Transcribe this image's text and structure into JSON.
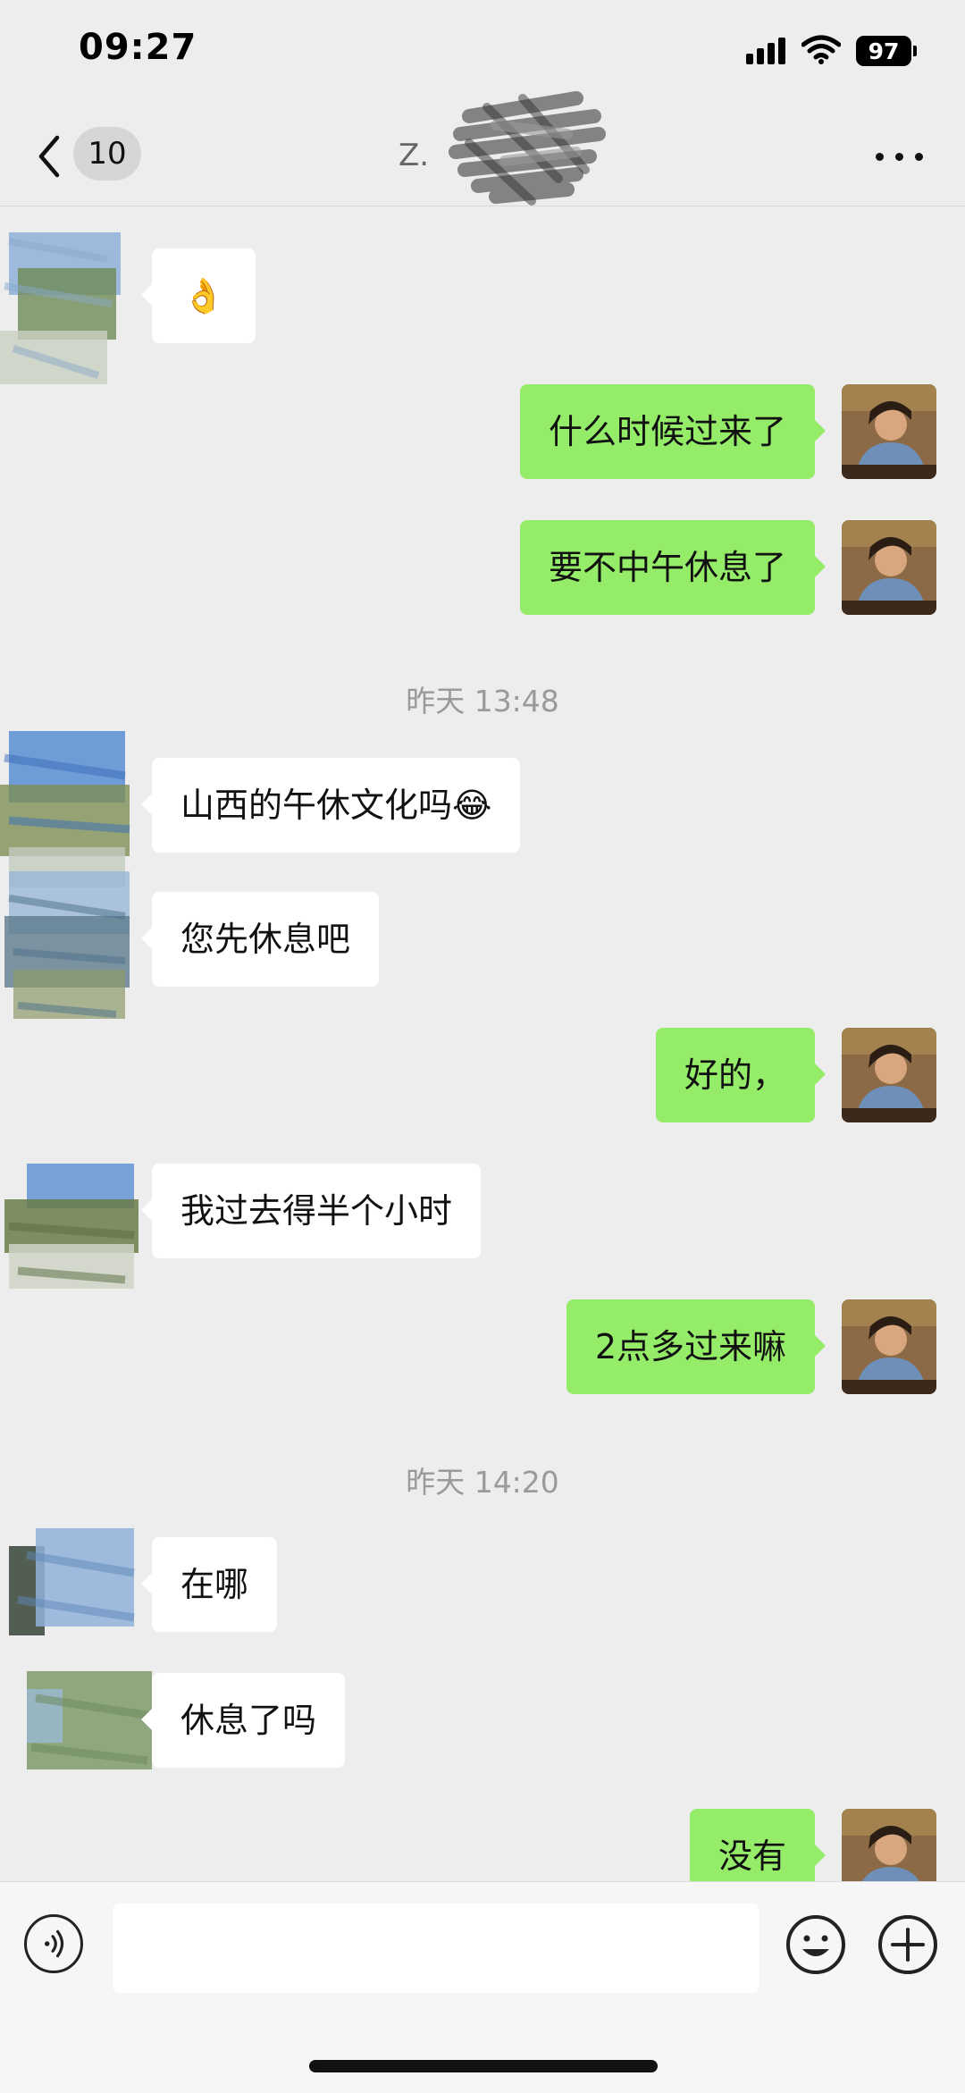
{
  "status_bar": {
    "time": "09:27",
    "battery": "97"
  },
  "nav": {
    "unread_count": "10",
    "title": "Z."
  },
  "messages": [
    {
      "side": "in",
      "text": "👌"
    },
    {
      "side": "out",
      "text": "什么时候过来了"
    },
    {
      "side": "out",
      "text": "要不中午休息了"
    },
    {
      "side": "in",
      "text": "山西的午休文化吗😂"
    },
    {
      "side": "in",
      "text": "您先休息吧"
    },
    {
      "side": "out",
      "text": "好的，"
    },
    {
      "side": "in",
      "text": "我过去得半个小时"
    },
    {
      "side": "out",
      "text": "2点多过来嘛"
    },
    {
      "side": "in",
      "text": "在哪"
    },
    {
      "side": "in",
      "text": "休息了吗"
    },
    {
      "side": "out",
      "text": "没有"
    }
  ],
  "timestamps": [
    "昨天 13:48",
    "昨天 14:20"
  ],
  "icons": {
    "back": "chevron-left-icon",
    "more": "more-dots-icon",
    "voice": "voice-icon",
    "emoji": "emoji-icon",
    "plus": "plus-icon"
  },
  "colors": {
    "outgoing_bubble": "#95ec69",
    "incoming_bubble": "#ffffff",
    "background": "#ededed"
  }
}
